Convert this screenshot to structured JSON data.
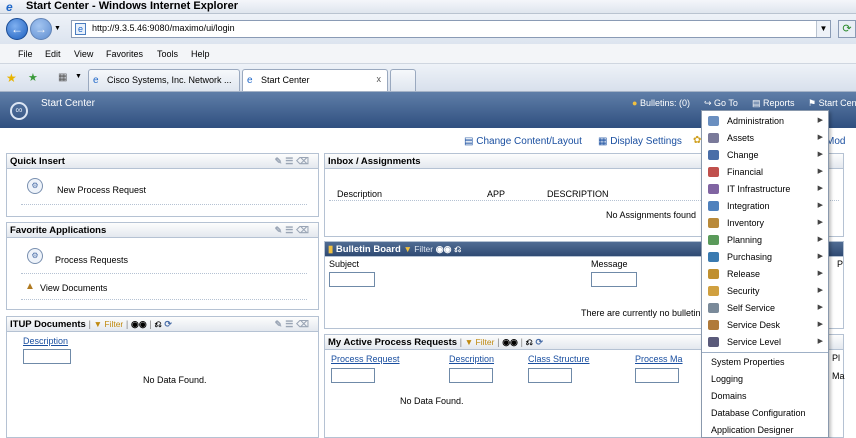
{
  "browser": {
    "window_title": "Start Center - Windows Internet Explorer",
    "url": "http://9.3.5.46:9080/maximo/ui/login",
    "menu": [
      "File",
      "Edit",
      "View",
      "Favorites",
      "Tools",
      "Help"
    ],
    "tabs": [
      {
        "label": "Cisco Systems, Inc. Network ..."
      },
      {
        "label": "Start Center"
      }
    ],
    "tab_close": "x"
  },
  "app": {
    "title": "Start Center",
    "bulletins": "Bulletins: (0)",
    "goto": "Go To",
    "reports": "Reports",
    "start_center": "Start Cen",
    "change_content": "Change Content/Layout",
    "display_settings": "Display Settings",
    "mod": "Mod"
  },
  "quick_insert": {
    "title": "Quick Insert",
    "items": [
      "New Process Request"
    ]
  },
  "favorite_apps": {
    "title": "Favorite Applications",
    "items": [
      "Process Requests",
      "View Documents"
    ]
  },
  "itup_documents": {
    "title": "ITUP Documents",
    "filter": "Filter",
    "column": "Description",
    "empty": "No Data Found."
  },
  "inbox": {
    "title": "Inbox / Assignments",
    "columns": [
      "Description",
      "APP",
      "DESCRIPTION"
    ],
    "empty": "No Assignments found"
  },
  "bulletin_board": {
    "title": "Bulletin Board",
    "filter": "Filter",
    "columns": [
      "Subject",
      "Message",
      "P"
    ],
    "empty": "There are currently no bulletin"
  },
  "active_requests": {
    "title": "My Active Process Requests",
    "filter": "Filter",
    "columns": [
      "Process Request",
      "Description",
      "Class Structure",
      "Process Ma"
    ],
    "extra_columns": [
      "Pl",
      "Ma"
    ],
    "empty": "No Data Found."
  },
  "goto_menu": {
    "items": [
      {
        "label": "Administration",
        "submenu": true,
        "color": "#6a8fc0"
      },
      {
        "label": "Assets",
        "submenu": true,
        "color": "#7a7a9a"
      },
      {
        "label": "Change",
        "submenu": true,
        "color": "#4a6ea8"
      },
      {
        "label": "Financial",
        "submenu": true,
        "color": "#c0504d"
      },
      {
        "label": "IT Infrastructure",
        "submenu": true,
        "color": "#8064a2"
      },
      {
        "label": "Integration",
        "submenu": true,
        "color": "#4f81bd"
      },
      {
        "label": "Inventory",
        "submenu": true,
        "color": "#b98a3a"
      },
      {
        "label": "Planning",
        "submenu": true,
        "color": "#5a9a5a"
      },
      {
        "label": "Purchasing",
        "submenu": true,
        "color": "#3a7ab0"
      },
      {
        "label": "Release",
        "submenu": true,
        "color": "#c09030"
      },
      {
        "label": "Security",
        "submenu": true,
        "color": "#d0a040"
      },
      {
        "label": "Self Service",
        "submenu": true,
        "color": "#7a8a9a"
      },
      {
        "label": "Service Desk",
        "submenu": true,
        "color": "#b07a3a"
      },
      {
        "label": "Service Level",
        "submenu": true,
        "color": "#5a5a7a"
      },
      {
        "label": "System Properties",
        "submenu": false
      },
      {
        "label": "Logging",
        "submenu": false
      },
      {
        "label": "Domains",
        "submenu": false
      },
      {
        "label": "Database Configuration",
        "submenu": false
      },
      {
        "label": "Application Designer",
        "submenu": false
      }
    ]
  }
}
